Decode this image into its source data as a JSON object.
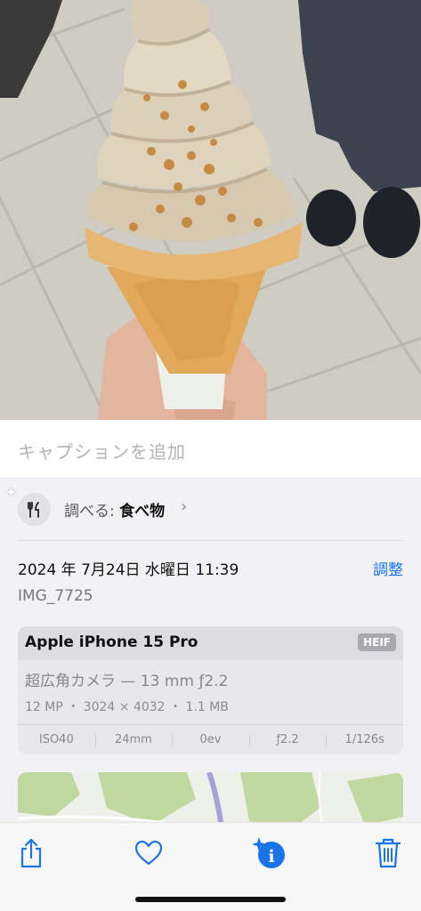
{
  "photo": {
    "subject_icon": "soft-serve-ice-cream-photo"
  },
  "caption": {
    "placeholder": "キャプションを追加"
  },
  "lookup": {
    "prefix": "調べる:",
    "value": "食べ物",
    "icon": "fork-knife-icon"
  },
  "info": {
    "datetime": "2024 年 7月24日 水曜日 11:39",
    "adjust_label": "調整",
    "filename": "IMG_7725"
  },
  "device": {
    "name": "Apple iPhone 15 Pro",
    "format_badge": "HEIF",
    "lens": "超広角カメラ — 13 mm ƒ2.2",
    "specs": "12 MP ・ 3024 × 4032 ・ 1.1 MB",
    "exif": [
      "ISO40",
      "24mm",
      "0ev",
      "ƒ2.2",
      "1/126s"
    ]
  },
  "toolbar": {
    "share_icon": "share-icon",
    "favorite_icon": "heart-icon",
    "info_icon": "info-sparkle-icon",
    "delete_icon": "trash-icon"
  },
  "colors": {
    "accent": "#1a73e8"
  }
}
